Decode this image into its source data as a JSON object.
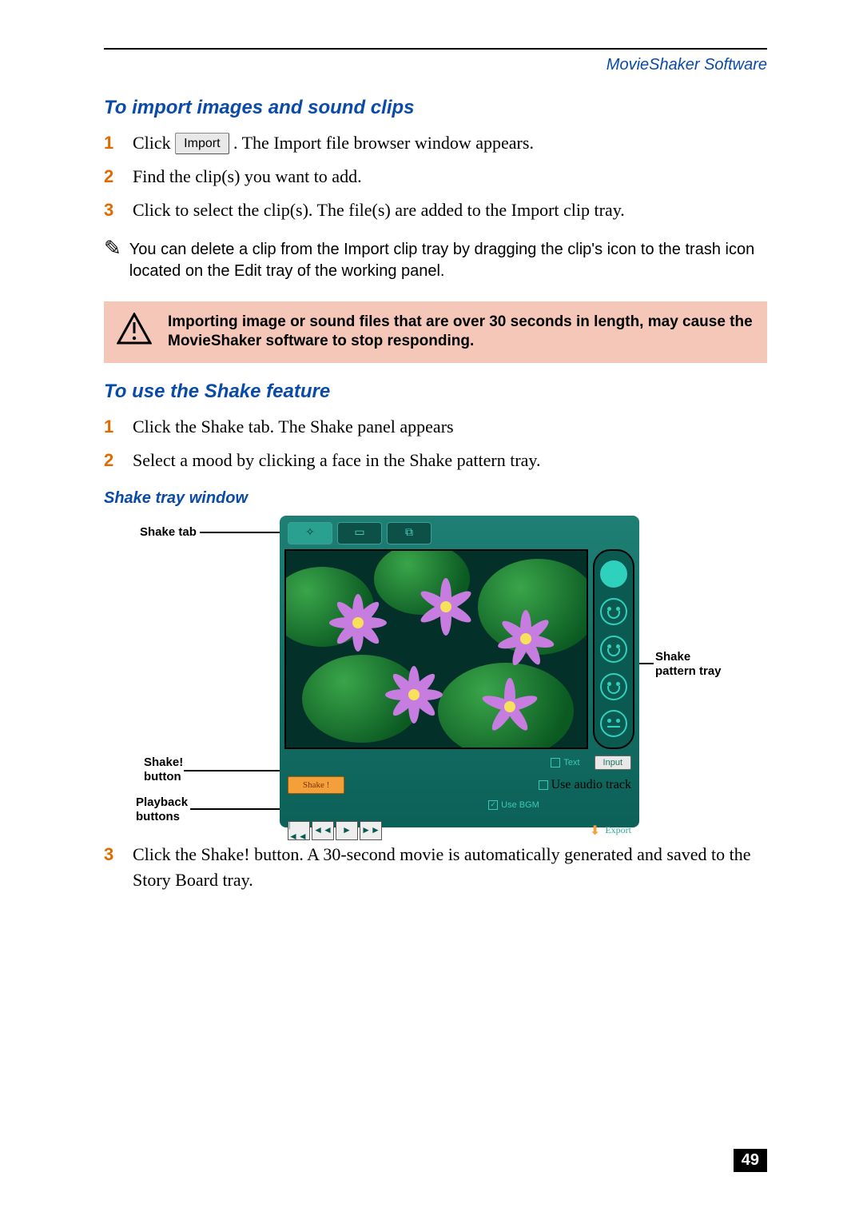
{
  "header": {
    "product": "MovieShaker Software"
  },
  "section1": {
    "title": "To import images and sound clips",
    "steps": [
      {
        "n": "1",
        "pre": "Click ",
        "button": "Import",
        "post": ". The Import file browser window appears."
      },
      {
        "n": "2",
        "text": "Find the clip(s) you want to add."
      },
      {
        "n": "3",
        "text": "Click to select the clip(s). The file(s) are added to the Import clip tray."
      }
    ]
  },
  "note": {
    "text": "You can delete a clip from the Import clip tray by dragging the clip's icon to the trash icon located on the Edit tray of the working panel."
  },
  "warning": {
    "text": "Importing image or sound files that are over 30 seconds in length, may cause the MovieShaker software to stop responding."
  },
  "section2": {
    "title": "To use the Shake feature",
    "steps_a": [
      {
        "n": "1",
        "text": "Click the Shake tab. The Shake panel appears"
      },
      {
        "n": "2",
        "text": "Select a mood by clicking a face in the Shake pattern tray."
      }
    ],
    "figure_title": "Shake tray window",
    "steps_b": [
      {
        "n": "3",
        "text": "Click the Shake! button. A 30-second movie is automatically generated and saved to the Story Board tray."
      }
    ]
  },
  "figure": {
    "callouts": {
      "shake_tab": "Shake tab",
      "pattern_tray_l1": "Shake",
      "pattern_tray_l2": "pattern tray",
      "shake_button_l1": "Shake!",
      "shake_button_l2": "button",
      "playback_l1": "Playback",
      "playback_l2": "buttons"
    },
    "ui": {
      "shake_button": "Shake !",
      "input_button": "Input",
      "opt_text": "Text",
      "opt_audio": "Use audio track",
      "opt_bgm": "Use BGM",
      "export": "Export"
    }
  },
  "page_number": "49"
}
